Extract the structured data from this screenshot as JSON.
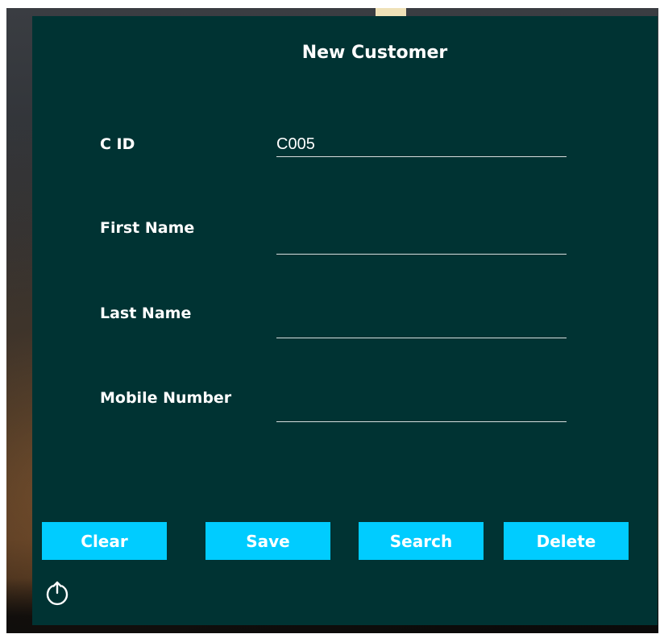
{
  "form": {
    "title": "New Customer",
    "fields": [
      {
        "label": "C ID",
        "value": "C005"
      },
      {
        "label": "First Name",
        "value": ""
      },
      {
        "label": "Last Name",
        "value": ""
      },
      {
        "label": "Mobile Number",
        "value": ""
      }
    ]
  },
  "buttons": {
    "clear": "Clear",
    "save": "Save",
    "search": "Search",
    "delete": "Delete"
  },
  "icons": {
    "exit": "power-icon"
  },
  "colors": {
    "panel_background": "#003333",
    "button_background": "#00ccff",
    "text": "#ffffff",
    "field_underline": "#d8dede"
  }
}
